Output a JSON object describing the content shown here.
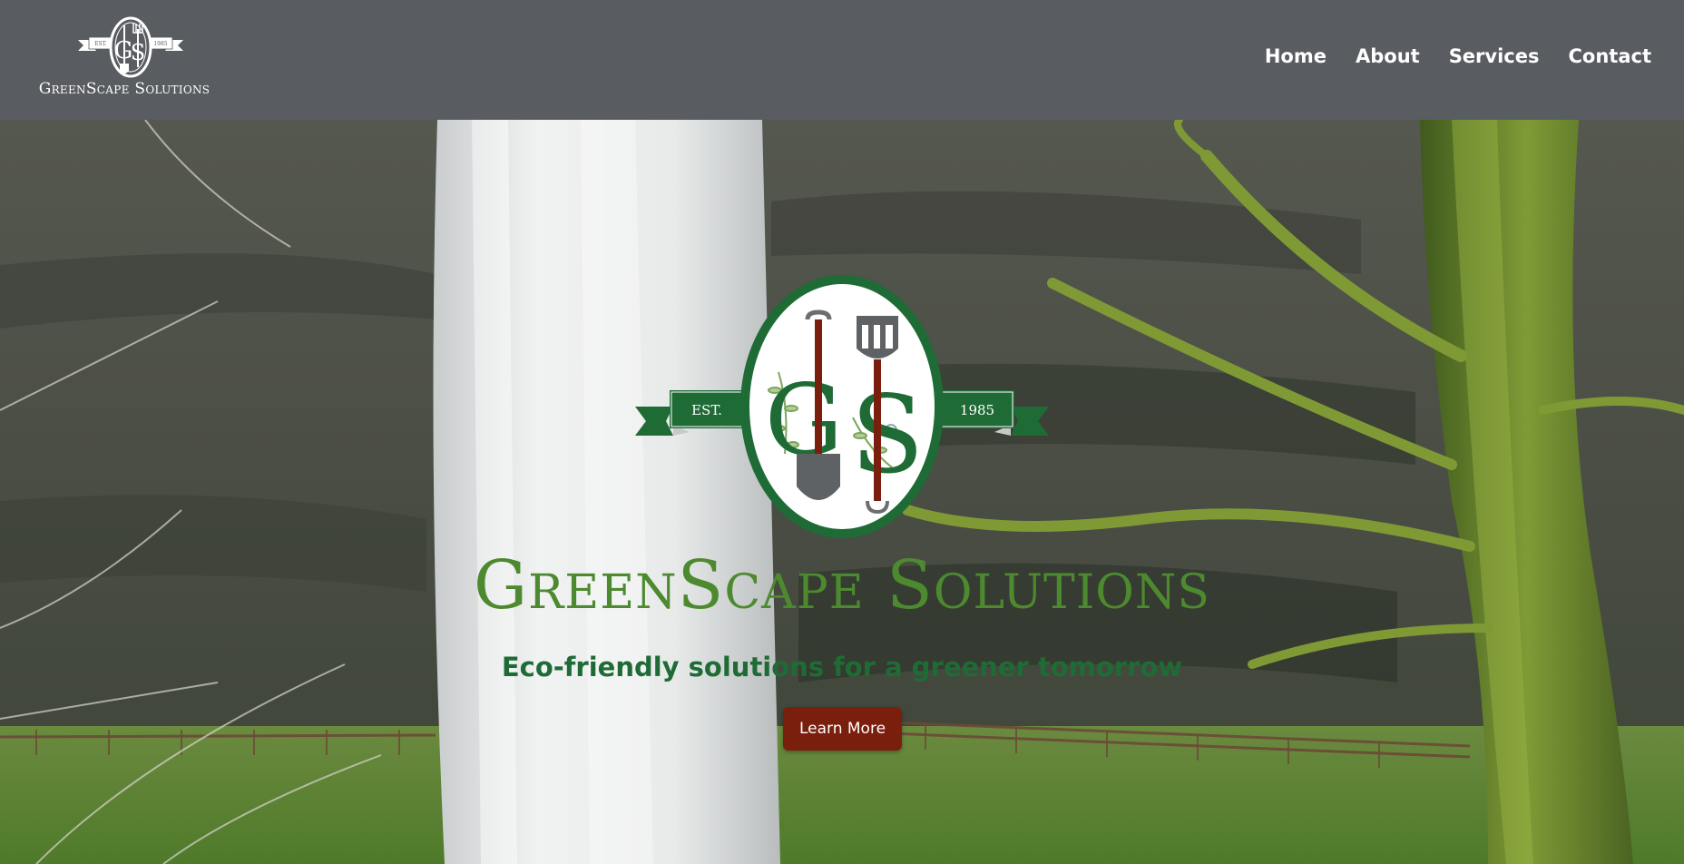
{
  "header": {
    "brand_name": "GreenScape Solutions",
    "brand_emblem_est": "EST.",
    "brand_emblem_year": "1985",
    "nav": [
      {
        "label": "Home"
      },
      {
        "label": "About"
      },
      {
        "label": "Services"
      },
      {
        "label": "Contact"
      }
    ]
  },
  "hero": {
    "emblem": {
      "est_label": "EST.",
      "year_label": "1985",
      "monogram_left": "G",
      "monogram_right": "S"
    },
    "title": "GreenScape Solutions",
    "tagline": "Eco-friendly solutions for a greener tomorrow",
    "cta_label": "Learn More"
  },
  "colors": {
    "header_bg": "#595c61",
    "brand_green": "#1f6b36",
    "title_green": "#4d8a2f",
    "cta_bg": "#7a1f0d",
    "nav_text": "#ffffff"
  },
  "icons": [
    "shovel-icon",
    "fork-icon",
    "ribbon-banner",
    "leaf-vine"
  ]
}
